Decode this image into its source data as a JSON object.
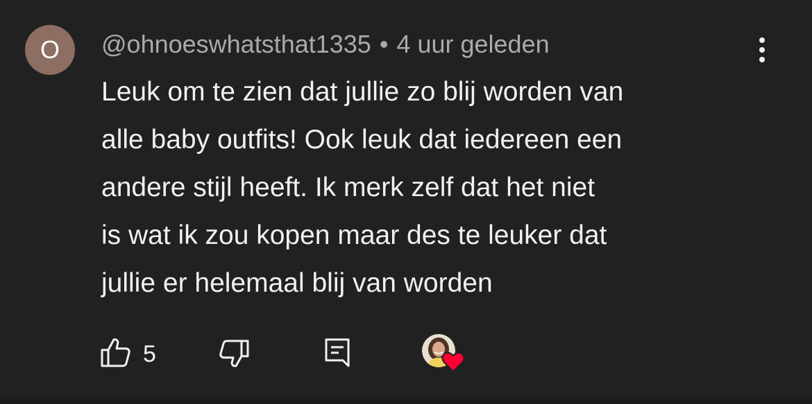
{
  "comment": {
    "avatar_letter": "O",
    "avatar_color": "#8d6e63",
    "author": "@ohnoeswhatsthat1335",
    "separator": "•",
    "time": "4 uur geleden",
    "lines": [
      "Leuk om te zien dat jullie zo blij worden van",
      "alle baby outfits! Ook leuk dat iedereen een",
      "andere stijl heeft. Ik merk zelf dat het niet",
      "is wat ik zou kopen maar des te leuker dat",
      "jullie er helemaal blij van worden"
    ],
    "like_count": "5",
    "icons": {
      "menu": "more-vert-icon",
      "like": "thumb-up-icon",
      "dislike": "thumb-down-icon",
      "reply": "reply-comment-icon",
      "creator_heart": "creator-heart-icon"
    },
    "heart_color": "#ff0033"
  }
}
